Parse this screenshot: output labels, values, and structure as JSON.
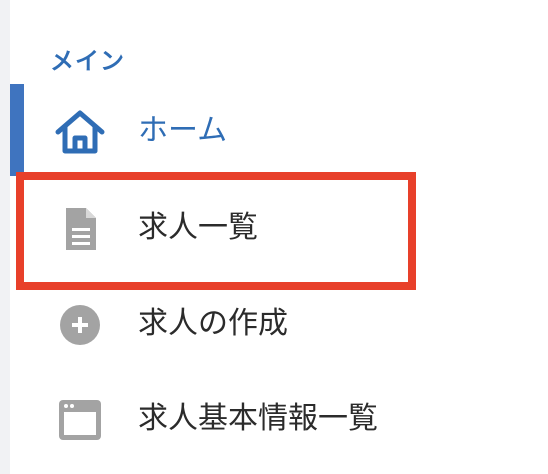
{
  "sidebar": {
    "section_label": "メイン",
    "items": [
      {
        "label": "ホーム",
        "icon": "home-icon",
        "active": true
      },
      {
        "label": "求人一覧",
        "icon": "document-icon",
        "active": false
      },
      {
        "label": "求人の作成",
        "icon": "plus-circle-icon",
        "active": false
      },
      {
        "label": "求人基本情報一覧",
        "icon": "window-icon",
        "active": false
      }
    ]
  },
  "colors": {
    "accent": "#2f6db5",
    "active_bar": "#3f74bf",
    "highlight": "#e8402a",
    "icon_gray": "#a3a3a3",
    "text": "#2b2b2b"
  }
}
